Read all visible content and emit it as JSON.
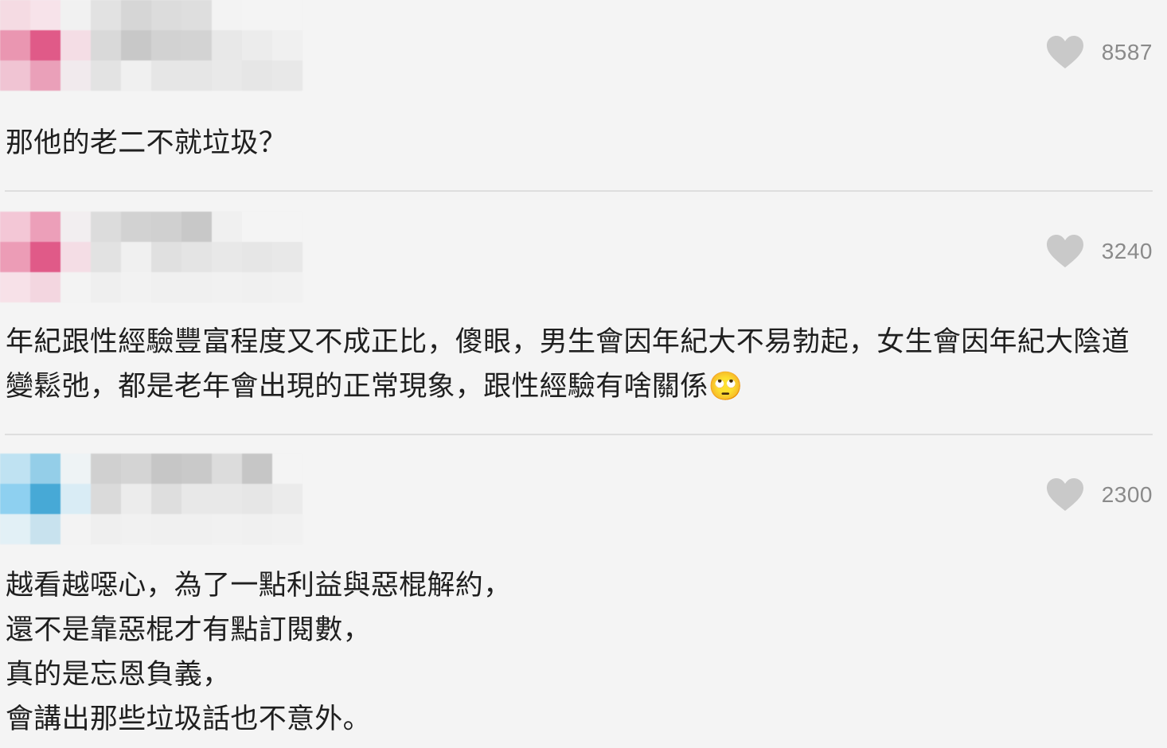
{
  "comments": [
    {
      "likes": "8587",
      "text": "那他的老二不就垃圾？",
      "avatar_color": "#e05a88"
    },
    {
      "likes": "3240",
      "text": "年紀跟性經驗豐富程度又不成正比，傻眼，男生會因年紀大不易勃起，女生會因年紀大陰道\n變鬆弛，都是老年會出現的正常現象，跟性經驗有啥關係🙄",
      "avatar_color": "#e05a88"
    },
    {
      "likes": "2300",
      "text": "越看越噁心，為了一點利益與惡棍解約，\n還不是靠惡棍才有點訂閱數，\n真的是忘恩負義，\n會講出那些垃圾話也不意外。",
      "avatar_color": "#47a9d6"
    }
  ],
  "colors": {
    "heart": "#c9c9c9",
    "like_count": "#8a8a8a",
    "background": "#f4f4f4",
    "divider": "#dedede"
  },
  "icons": {
    "like": "heart-icon"
  }
}
